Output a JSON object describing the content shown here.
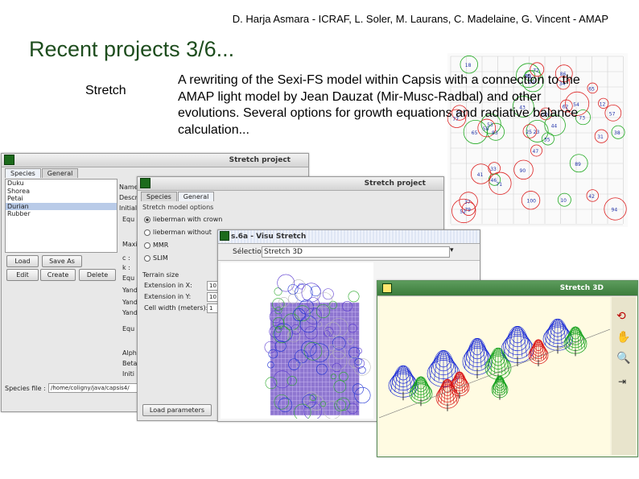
{
  "header": {
    "authors": "D. Harja Asmara - ICRAF, L. Soler, M. Laurans, C. Madelaine, G. Vincent - AMAP",
    "title": "Recent projects 3/6..."
  },
  "section_label": "Stretch",
  "description": "A rewriting of the Sexi-FS model within Capsis with a connection to the AMAP light model by Jean Dauzat (Mir-Musc-Radbal) and other evolutions. Several options for growth equations and radiative balance calculation...",
  "scatter_numbers": [
    "47",
    "83",
    "37",
    "43",
    "86",
    "33",
    "35",
    "52",
    "65",
    "58",
    "62",
    "38",
    "50",
    "73",
    "79",
    "31",
    "44",
    "34",
    "51",
    "90",
    "57",
    "23",
    "25",
    "46",
    "71",
    "94",
    "89",
    "15",
    "53",
    "54",
    "77",
    "56",
    "100",
    "22",
    "12",
    "41",
    "10",
    "65",
    "18",
    "42",
    "72"
  ],
  "windows": {
    "stretch_project": {
      "title": "Stretch project",
      "tabs": [
        "Species",
        "General"
      ],
      "species": [
        "Duku",
        "Shorea",
        "Petai",
        "Durian",
        "Rubber"
      ],
      "selected_index": 3,
      "side_labels": [
        "Name",
        "Descr",
        "Initial",
        "Equ",
        "Maxi",
        "c :",
        "k :",
        "Equ",
        "Yand",
        "Yand",
        "Yand",
        "Equ",
        "Alph",
        "Beta",
        "Initi"
      ],
      "buttons": [
        "Load",
        "Save As",
        "Edit",
        "Create",
        "Delete"
      ],
      "species_file_label": "Species file :",
      "species_file_value": "/home/coligny/java/capsis4/"
    },
    "stretch_project_2": {
      "title": "Stretch project",
      "tabs": [
        "Species",
        "General"
      ],
      "model_options_label": "Stretch model options",
      "options": [
        "lieberman with crown",
        "lieberman without",
        "MMR",
        "SLIM"
      ],
      "selected_option": 0,
      "terrain_label": "Terrain size",
      "terrain_fields": [
        {
          "label": "Extension in X:",
          "value": "10"
        },
        {
          "label": "Extension in Y:",
          "value": "10"
        },
        {
          "label": "Cell width (meters):",
          "value": "1"
        }
      ],
      "load_button": "Load parameters"
    },
    "visu": {
      "title": "s.6a - Visu Stretch",
      "selection_label": "Sélection:",
      "selection_value": "Stretch 3D"
    },
    "stretch3d": {
      "title": "Stretch 3D"
    }
  },
  "colors": {
    "title_green": "#1e4d1e",
    "tree_blue": "#1a2bd6",
    "tree_red": "#d81414",
    "tree_green": "#12a01a",
    "grid_purple": "#7a5ec8"
  }
}
